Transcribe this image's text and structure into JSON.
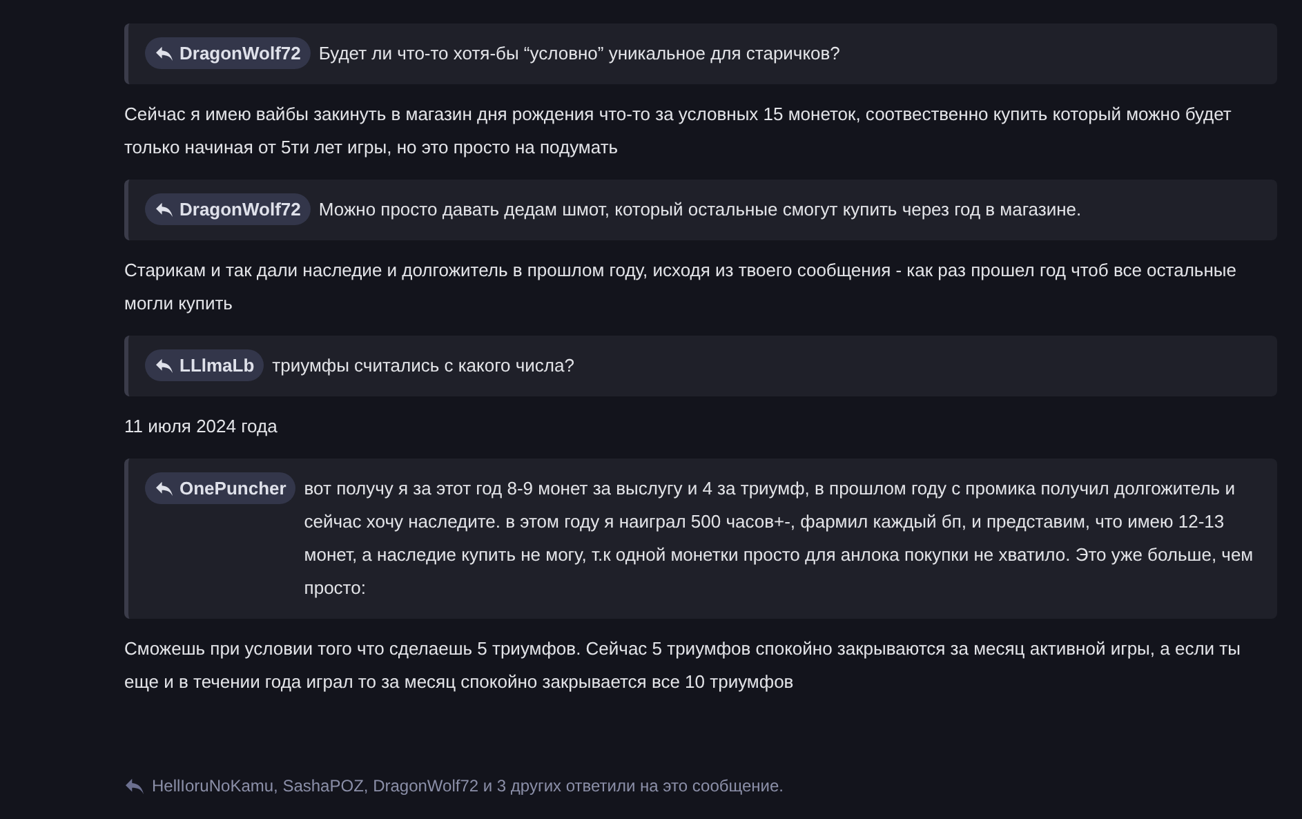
{
  "posts": [
    {
      "kind": "quote",
      "author": "DragonWolf72",
      "text": "Будет ли что-то хотя-бы “условно” уникальное для старичков?"
    },
    {
      "kind": "text",
      "text": "Сейчас я имею вайбы закинуть в магазин дня рождения что-то за условных 15 монеток, соотвественно купить который можно будет только начиная от 5ти лет игры, но это просто на подумать"
    },
    {
      "kind": "quote",
      "author": "DragonWolf72",
      "text": "Можно просто давать дедам шмот, который остальные смогут купить через год в магазине."
    },
    {
      "kind": "text",
      "text": "Старикам и так дали наследие и долгожитель в прошлом году, исходя из твоего сообщения - как раз прошел год чтоб все остальные могли купить"
    },
    {
      "kind": "quote",
      "author": "LLlmaLb",
      "text": "триумфы считались с какого числа?"
    },
    {
      "kind": "text",
      "text": "11 июля 2024 года"
    },
    {
      "kind": "quote",
      "author": "OnePuncher",
      "text": "вот получу я за этот год 8-9 монет за выслугу и 4 за триумф, в прошлом году с промика получил долгожитель и сейчас хочу наследите. в этом году я наиграл 500 часов+-, фармил каждый бп, и представим, что имею 12-13 монет, а наследие купить не могу, т.к одной монетки просто для анлока покупки не хватило. Это уже больше, чем просто:"
    },
    {
      "kind": "text",
      "text": "Сможешь при условии того что сделаешь 5 триумфов. Сейчас 5 триумфов спокойно закрываются за месяц активной игры, а если ты еще и в течении года играл то за месяц спокойно закрывается все 10 триумфов"
    }
  ],
  "replies": "HellIoruNoKamu, SashaPOZ, DragonWolf72 и 3 других ответили на это сообщение."
}
